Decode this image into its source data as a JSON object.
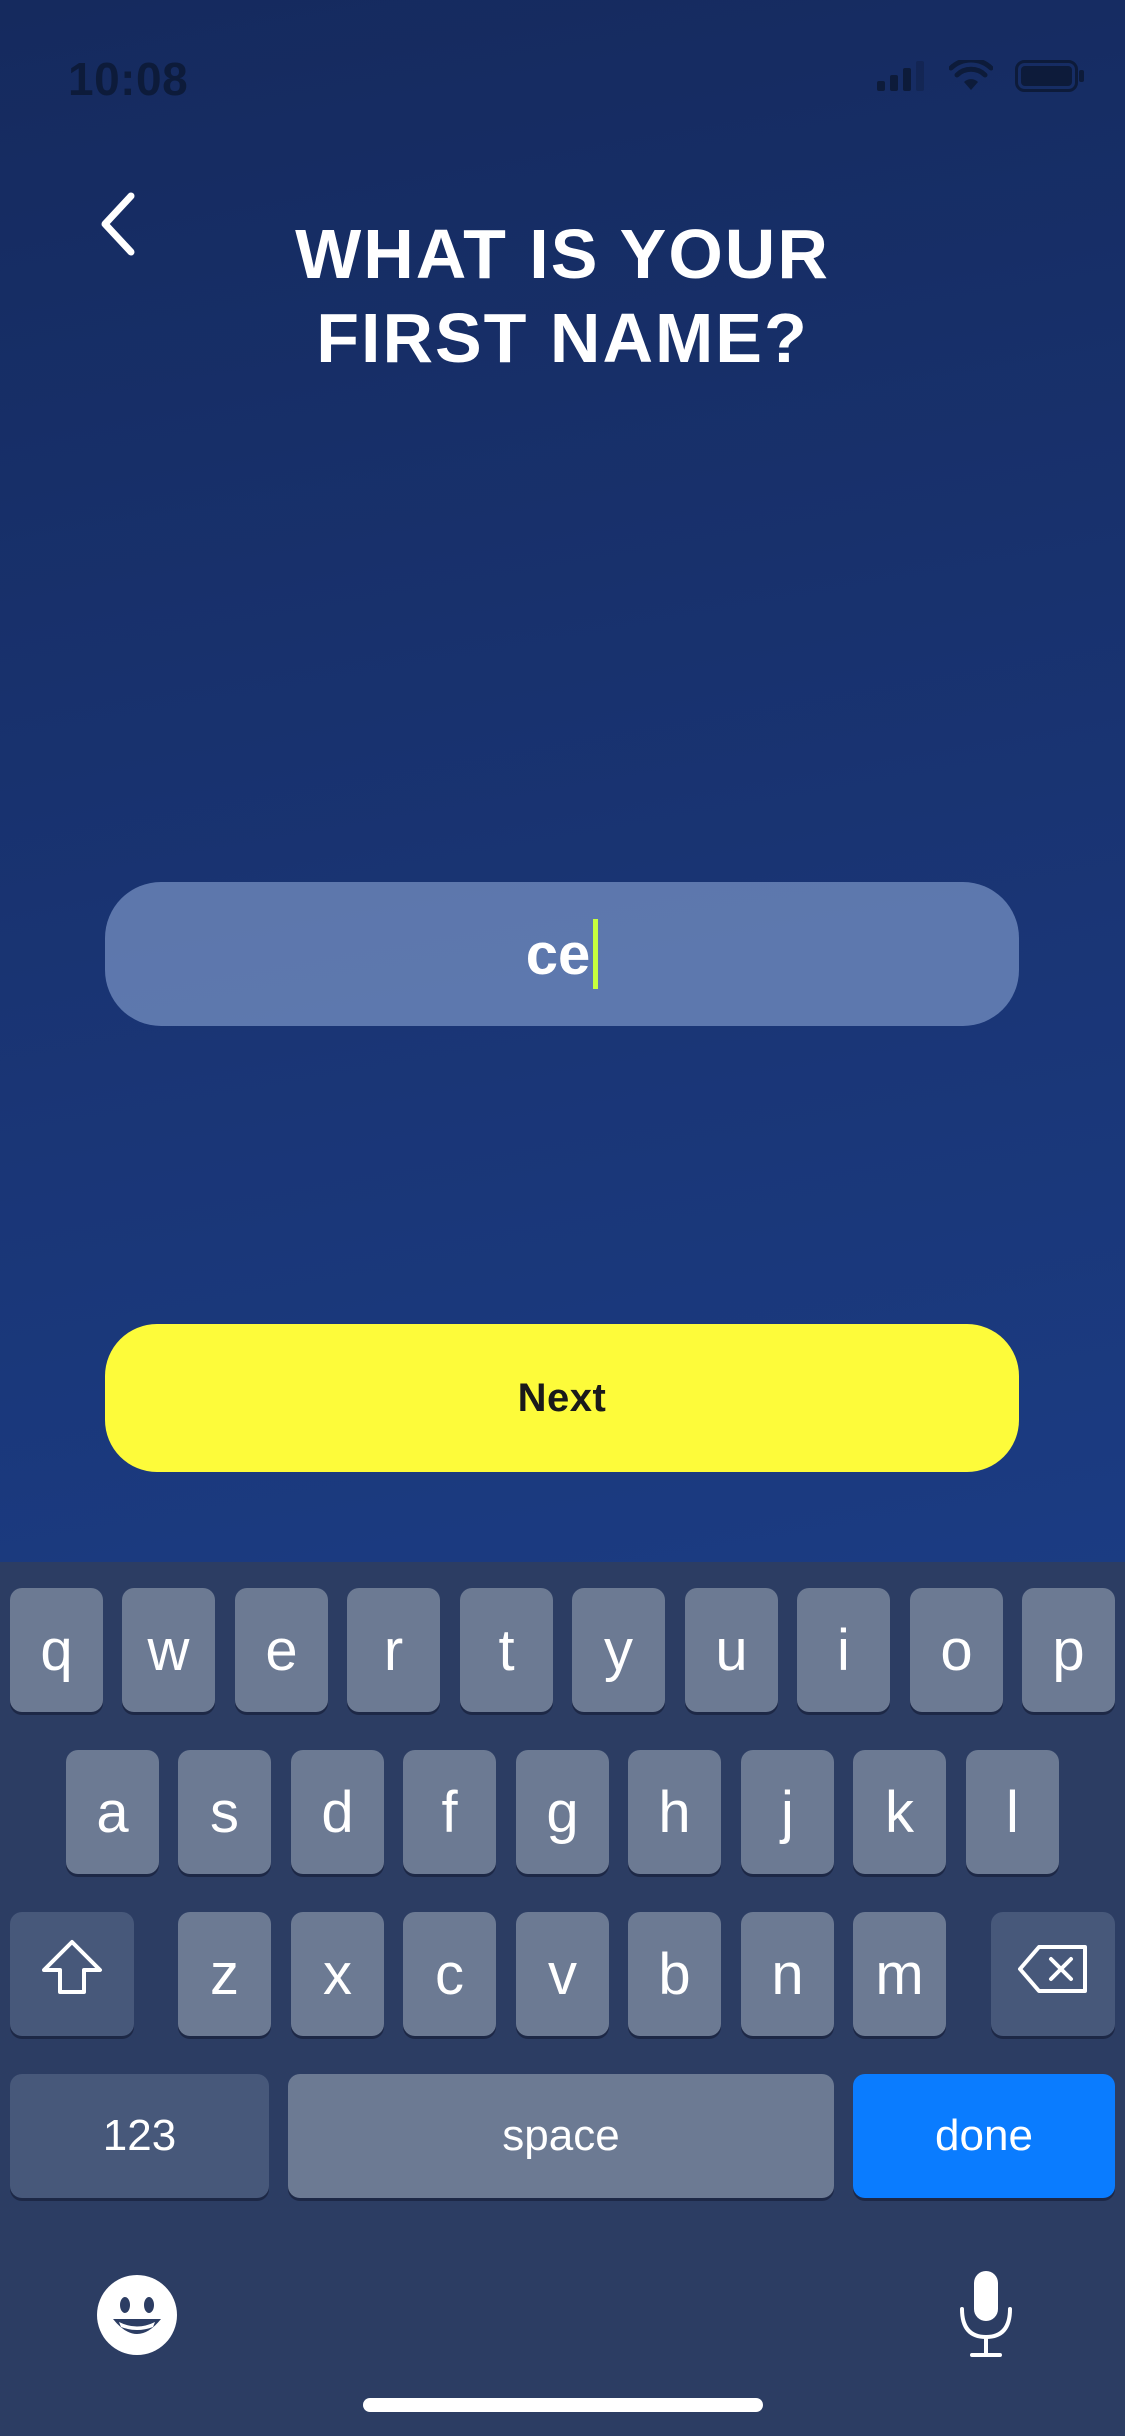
{
  "status_bar": {
    "time": "10:08",
    "icons": [
      "cellular-signal-icon",
      "wifi-icon",
      "battery-icon"
    ]
  },
  "header": {
    "back_icon": "chevron-left-icon",
    "title_line1": "WHAT IS YOUR",
    "title_line2": "FIRST NAME?"
  },
  "name_field": {
    "value": "ce"
  },
  "next_button": {
    "label": "Next"
  },
  "keyboard": {
    "row1": [
      "q",
      "w",
      "e",
      "r",
      "t",
      "y",
      "u",
      "i",
      "o",
      "p"
    ],
    "row2": [
      "a",
      "s",
      "d",
      "f",
      "g",
      "h",
      "j",
      "k",
      "l"
    ],
    "row3": [
      "z",
      "x",
      "c",
      "v",
      "b",
      "n",
      "m"
    ],
    "numbers_label": "123",
    "space_label": "space",
    "done_label": "done",
    "icons": [
      "shift-icon",
      "backspace-icon",
      "emoji-icon",
      "microphone-icon"
    ]
  },
  "colors": {
    "background_top": "#152a5e",
    "background_bottom": "#1d4494",
    "accent_yellow": "#fdfb3a",
    "caret_green": "#c7ff3d",
    "done_blue": "#0a7cff"
  }
}
